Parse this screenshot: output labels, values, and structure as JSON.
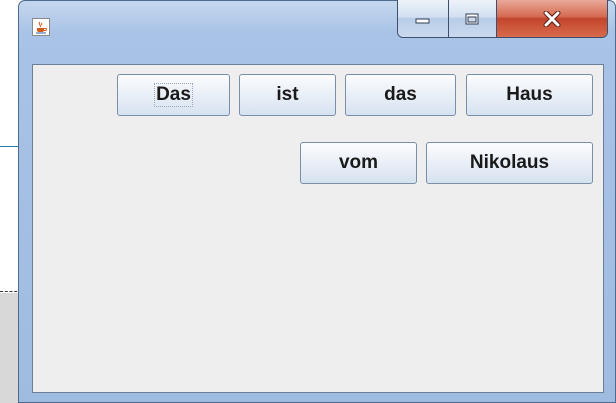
{
  "window": {
    "title_icon": "java-coffee-cup-icon",
    "caption_buttons": [
      {
        "name": "minimize",
        "icon": "minimize-icon"
      },
      {
        "name": "maximize",
        "icon": "maximize-icon"
      },
      {
        "name": "close",
        "icon": "close-icon"
      }
    ]
  },
  "buttons": {
    "b1": "Das",
    "b2": "ist",
    "b3": "das",
    "b4": "Haus",
    "b5": "vom",
    "b6": "Nikolaus"
  },
  "colors": {
    "titlebar": "#a9c3e6",
    "content_bg": "#eeeeee",
    "close_button": "#c2452c"
  }
}
